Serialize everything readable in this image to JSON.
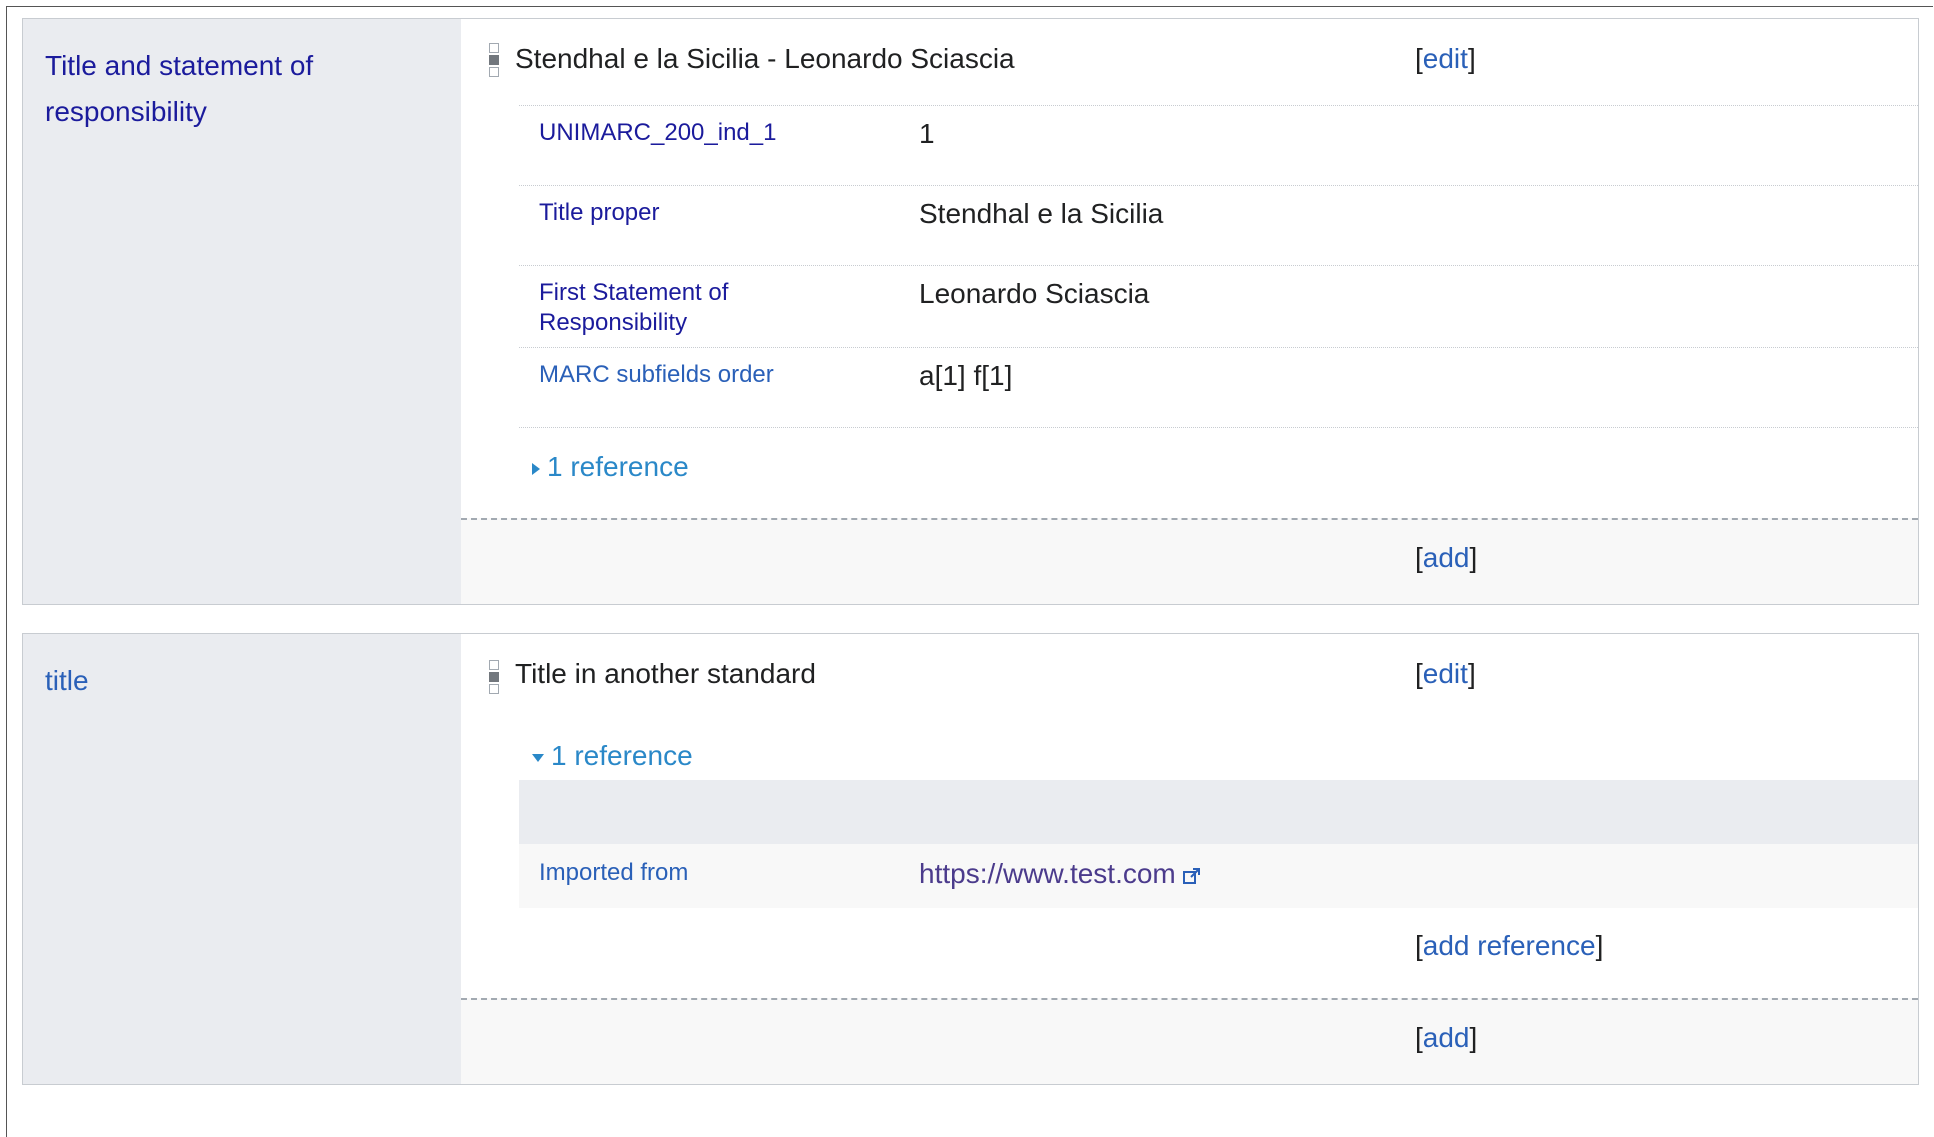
{
  "group1": {
    "property": "Title and statement of responsibility",
    "value": "Stendhal e la Sicilia - Leonardo Sciascia",
    "edit_label": "edit",
    "qualifiers": [
      {
        "property": "UNIMARC_200_ind_1",
        "value": "1"
      },
      {
        "property": "Title proper",
        "value": "Stendhal e la Sicilia"
      },
      {
        "property": "First Statement of Responsibility",
        "value": "Leonardo Sciascia"
      },
      {
        "property": "MARC subfields order",
        "value": "a[1] f[1]"
      }
    ],
    "references_toggle": "1 reference",
    "add_label": "add"
  },
  "group2": {
    "property": "title",
    "value": "Title in another standard",
    "edit_label": "edit",
    "references_toggle": "1 reference",
    "reference": {
      "property": "Imported from",
      "value": "https://www.test.com"
    },
    "add_reference_label": "add reference",
    "add_label": "add"
  },
  "icons": {
    "rank": "rank-normal-icon",
    "collapsed": "triangle-right-icon",
    "expanded": "triangle-down-icon",
    "external": "external-link-icon"
  },
  "colors": {
    "property_label": "#1b1b9c",
    "link": "#2a60b8",
    "reference_toggle": "#2a88c8",
    "label_background": "#eaecf0",
    "visited_link": "#4b3b8c"
  }
}
